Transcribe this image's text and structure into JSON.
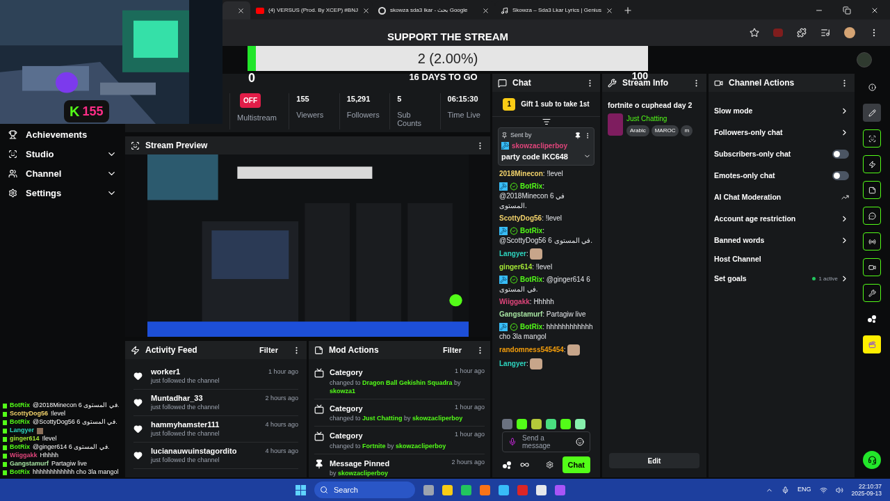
{
  "browser": {
    "tabs": [
      {
        "selected": true
      },
      {
        "title": "(4) VERSUS (Prod. By XCEP) #BNJ",
        "selected": false
      },
      {
        "title": "skowza sda3 lkar - بحث Google",
        "selected": false
      },
      {
        "title": "Skowza – Sda3 Lkar Lyrics | Genius",
        "selected": false
      }
    ]
  },
  "webcam": {
    "kind": "picture",
    "badge_letter": "K",
    "badge_count": "155"
  },
  "goal": {
    "title": "SUPPORT THE STREAM",
    "progress_text": "2 (2.00%)",
    "level": 0.02,
    "start": "0",
    "end": "100",
    "countdown": "16 DAYS TO GO"
  },
  "sidebar": {
    "items": [
      {
        "label": "Achievements"
      },
      {
        "label": "Studio",
        "expanded": false
      },
      {
        "label": "Channel",
        "expanded": false
      },
      {
        "label": "Settings",
        "expanded": false
      }
    ]
  },
  "stats": [
    {
      "kind": "toggle",
      "value": "OFF",
      "label": "Multistream",
      "on": false
    },
    {
      "kind": "number",
      "value": "155",
      "label": "Viewers"
    },
    {
      "kind": "number",
      "value": "15,291",
      "label": "Followers"
    },
    {
      "kind": "number",
      "value": "5",
      "label": "Sub Counts"
    },
    {
      "kind": "number",
      "value": "06:15:30",
      "label": "Time Live"
    }
  ],
  "stream_preview": {
    "title": "Stream Preview",
    "kind": "picture"
  },
  "activity_feed": {
    "title": "Activity Feed",
    "filter": "Filter",
    "items": [
      {
        "name": "worker1",
        "text": "just followed the channel",
        "time": "1 hour ago"
      },
      {
        "name": "Muntadhar_33",
        "text": "just followed the channel",
        "time": "2 hours ago"
      },
      {
        "name": "hammyhamster111",
        "text": "just followed the channel",
        "time": "4 hours ago"
      },
      {
        "name": "lucianauwuinstagordito",
        "text": "just followed the channel",
        "time": "4 hours ago"
      }
    ]
  },
  "mod_actions": {
    "title": "Mod Actions",
    "filter": "Filter",
    "items": [
      {
        "kind": "category",
        "title": "Category",
        "time": "1 hour ago",
        "prefix": "changed to",
        "target": "Dragon Ball Gekishin Squadra",
        "by": "by",
        "user": "skowza1"
      },
      {
        "kind": "category",
        "title": "Category",
        "time": "1 hour ago",
        "prefix": "changed to",
        "target": "Just Chatting",
        "by": "by",
        "user": "skowzacliperboy"
      },
      {
        "kind": "category",
        "title": "Category",
        "time": "1 hour ago",
        "prefix": "changed to",
        "target": "Fortnite",
        "by": "by",
        "user": "skowzacliperboy"
      },
      {
        "kind": "pin",
        "title": "Message Pinned",
        "time": "2 hours ago",
        "by": "by",
        "user": "skowzacliperboy"
      }
    ]
  },
  "chat": {
    "title": "Chat",
    "gift_rank": "1",
    "gift_text": "Gift 1 sub to take 1st",
    "pinned": {
      "label": "Sent by",
      "user": "skowzacliperboy",
      "color": "#e0457b",
      "text": "party code IKC648"
    },
    "messages": [
      {
        "kind": "user",
        "user": "2018Minecon",
        "sep": ":",
        "color": "#f3d36b",
        "text": "!level"
      },
      {
        "kind": "bot",
        "user": "BotRix",
        "sep": ":",
        "color": "#53fc18",
        "text": "@2018Minecon 6 في المستوى."
      },
      {
        "kind": "user",
        "user": "ScottyDog56",
        "sep": ":",
        "color": "#f3d36b",
        "text": "!level"
      },
      {
        "kind": "bot",
        "user": "BotRix",
        "sep": ":",
        "color": "#53fc18",
        "text": "@ScottyDog56 6 في المستوى."
      },
      {
        "kind": "emote",
        "user": "Langyer",
        "sep": ":",
        "color": "#2dd4bf"
      },
      {
        "kind": "user",
        "user": "ginger614",
        "sep": ":",
        "color": "#a3e635",
        "text": "!level"
      },
      {
        "kind": "bot",
        "user": "BotRix",
        "sep": ":",
        "color": "#53fc18",
        "text": "@ginger614 6 في المستوى."
      },
      {
        "kind": "user",
        "user": "Wiiggakk",
        "sep": ":",
        "color": "#e0457b",
        "text": "Hhhhh"
      },
      {
        "kind": "user",
        "user": "Gangstamurf",
        "sep": ":",
        "color": "#a6e3a1",
        "text": "Partagiw live"
      },
      {
        "kind": "bot",
        "user": "BotRix",
        "sep": ":",
        "color": "#53fc18",
        "text": "hhhhhhhhhhhh cho 3la mangol"
      },
      {
        "kind": "emote",
        "user": "randomness545454",
        "sep": ":",
        "color": "#f59e0b"
      },
      {
        "kind": "emote",
        "user": "Langyer",
        "sep": ":",
        "color": "#2dd4bf"
      }
    ],
    "input": {
      "placeholder": "Send a message"
    },
    "send": "Chat"
  },
  "stream_info": {
    "title": "Stream Info",
    "stream_title": "fortnite o cuphead day 2",
    "category": "Just Chatting",
    "tags": [
      "Arabic",
      "MAROC",
      "m"
    ],
    "edit": "Edit"
  },
  "channel_actions": {
    "title": "Channel Actions",
    "items": [
      {
        "kind": "link",
        "label": "Slow mode"
      },
      {
        "kind": "link",
        "label": "Followers-only chat"
      },
      {
        "kind": "toggle",
        "label": "Subscribers-only chat",
        "on": false
      },
      {
        "kind": "toggle",
        "label": "Emotes-only chat",
        "on": false
      },
      {
        "kind": "external",
        "label": "AI Chat Moderation"
      },
      {
        "kind": "link",
        "label": "Account age restriction"
      },
      {
        "kind": "link",
        "label": "Banned words"
      },
      {
        "kind": "plain",
        "label": "Host Channel"
      },
      {
        "kind": "status",
        "label": "Set goals",
        "status": "1 active"
      }
    ]
  },
  "right_rail": [
    {
      "selected": false
    },
    {
      "selected": true
    },
    {
      "selected": false
    },
    {
      "selected": false
    },
    {
      "selected": false
    },
    {
      "selected": false
    },
    {
      "selected": false
    },
    {
      "selected": false
    },
    {
      "selected": false
    },
    {
      "selected": false
    },
    {
      "selected": false
    }
  ],
  "overlay_chat": [
    {
      "kind": "bot",
      "user": "BotRix",
      "color": "#53fc18",
      "text": "@2018Minecon 6 في المستوى."
    },
    {
      "kind": "user",
      "user": "ScottyDog56",
      "color": "#f3d36b",
      "text": "!level"
    },
    {
      "kind": "bot",
      "user": "BotRix",
      "color": "#53fc18",
      "text": "@ScottyDog56 6 في المستوى."
    },
    {
      "kind": "emote",
      "user": "Langyer",
      "color": "#2dd4bf"
    },
    {
      "kind": "user",
      "user": "ginger614",
      "color": "#a3e635",
      "text": "!level"
    },
    {
      "kind": "bot",
      "user": "BotRix",
      "color": "#53fc18",
      "text": "@ginger614 6 في المستوى."
    },
    {
      "kind": "user",
      "user": "Wiiggakk",
      "color": "#e0457b",
      "text": "Hhhhh"
    },
    {
      "kind": "user",
      "user": "Gangstamurf",
      "color": "#a6e3a1",
      "text": "Partagiw live"
    },
    {
      "kind": "bot",
      "user": "BotRix",
      "color": "#53fc18",
      "text": "hhhhhhhhhhhh cho 3la mangol"
    }
  ],
  "taskbar": {
    "search": "Search",
    "language": "ENG",
    "time": "22:10:37",
    "date": "2025-09-13"
  }
}
